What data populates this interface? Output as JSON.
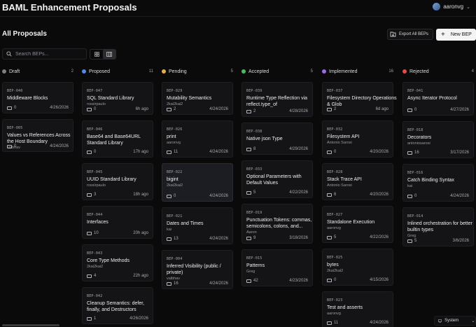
{
  "app": {
    "title": "BAML Enhancement Proposals"
  },
  "user": {
    "name": "aaronvg"
  },
  "page": {
    "title": "All Proposals"
  },
  "actions": {
    "export_label": "Export All BEPs",
    "new_label": "New BEP"
  },
  "search": {
    "placeholder": "Search BEPs..."
  },
  "theme": {
    "label": "System"
  },
  "colors": {
    "draft": "#7d7d85",
    "proposed": "#4f8be8",
    "pending": "#e3b341",
    "accepted": "#4cbb5f",
    "implemented": "#9b6be3",
    "rejected": "#e34b4b"
  },
  "columns": [
    {
      "name": "Draft",
      "count": "2",
      "cards": [
        {
          "id": "BEP-040",
          "title": "Middleware Blocks",
          "author": "",
          "comments": "0",
          "date": "4/26/2026"
        },
        {
          "id": "BEP-005",
          "title": "Values vs References Across the Host Boundary",
          "author": "vaibhav",
          "comments": "0",
          "date": "4/24/2026"
        }
      ]
    },
    {
      "name": "Proposed",
      "count": "11",
      "cards": [
        {
          "id": "BEP-047",
          "title": "SQL Standard Library",
          "author": "rossirpaulo",
          "comments": "0",
          "date": "6h ago"
        },
        {
          "id": "BEP-046",
          "title": "Base64 and Base64URL Standard Library",
          "author": "",
          "comments": "0",
          "date": "17h ago"
        },
        {
          "id": "BEP-045",
          "title": "UUID Standard Library",
          "author": "rossirpaulo",
          "comments": "3",
          "date": "18h ago"
        },
        {
          "id": "BEP-044",
          "title": "Interfaces",
          "author": "",
          "comments": "10",
          "date": "20h ago"
        },
        {
          "id": "BEP-043",
          "title": "Core Type Methods",
          "author": "2kai2kai2",
          "comments": "4",
          "date": "22h ago"
        },
        {
          "id": "BEP-042",
          "title": "Cleanup Semantics: defer, finally, and Destructors",
          "author": "",
          "comments": "1",
          "date": "4/26/2026"
        }
      ]
    },
    {
      "name": "Pending",
      "count": "5",
      "cards": [
        {
          "id": "BEP-029",
          "title": "Mutability Semantics",
          "author": "2kai2kai2",
          "comments": "2",
          "date": "4/24/2026"
        },
        {
          "id": "BEP-026",
          "title": "print",
          "author": "aaronvg",
          "comments": "11",
          "date": "4/24/2026"
        },
        {
          "id": "BEP-022",
          "title": "bigint",
          "author": "2kai2kai2",
          "comments": "0",
          "date": "4/24/2026"
        },
        {
          "id": "BEP-021",
          "title": "Dates and Times",
          "author": "kai",
          "comments": "13",
          "date": "4/24/2026"
        },
        {
          "id": "BEP-004",
          "title": "Inferred Visibility (public / private)",
          "author": "vaibhav",
          "comments": "16",
          "date": "4/24/2026"
        }
      ]
    },
    {
      "name": "Accepted",
      "count": "5",
      "cards": [
        {
          "id": "BEP-039",
          "title": "Runtime Type Reflection via reflect.type_of",
          "author": "",
          "comments": "2",
          "date": "4/28/2026"
        },
        {
          "id": "BEP-038",
          "title": "Native json Type",
          "author": "",
          "comments": "8",
          "date": "4/29/2026"
        },
        {
          "id": "BEP-033",
          "title": "Optional Parameters with Default Values",
          "author": "",
          "comments": "5",
          "date": "4/22/2026"
        },
        {
          "id": "BEP-019",
          "title": "Punctuation Tokens: commas, semicolons, colons, and...",
          "author": "Aaron",
          "comments": "9",
          "date": "3/18/2026"
        },
        {
          "id": "BEP-015",
          "title": "Patterns",
          "author": "Greg",
          "comments": "42",
          "date": "4/23/2026"
        }
      ]
    },
    {
      "name": "Implemented",
      "count": "16",
      "cards": [
        {
          "id": "BEP-037",
          "title": "Filesystem Directory Operations & Glob",
          "author": "",
          "comments": "2",
          "date": "6d ago"
        },
        {
          "id": "BEP-032",
          "title": "Filesystem API",
          "author": "Antonio Sarosi",
          "comments": "0",
          "date": "4/20/2026"
        },
        {
          "id": "BEP-028",
          "title": "Stack Trace API",
          "author": "Antonio Sarosi",
          "comments": "6",
          "date": "4/20/2026"
        },
        {
          "id": "BEP-027",
          "title": "Standalone Execution",
          "author": "aaronvg",
          "comments": "5",
          "date": "4/22/2026"
        },
        {
          "id": "BEP-025",
          "title": "bytes",
          "author": "2kai2kai2",
          "comments": "0",
          "date": "4/15/2026"
        },
        {
          "id": "BEP-023",
          "title": "Test and asserts",
          "author": "aaronvg",
          "comments": "11",
          "date": "4/24/2026"
        }
      ]
    },
    {
      "name": "Rejected",
      "count": "4",
      "cards": [
        {
          "id": "BEP-041",
          "title": "Async Iterator Protocol",
          "author": "",
          "comments": "0",
          "date": "4/27/2026"
        },
        {
          "id": "BEP-018",
          "title": "Decorators",
          "author": "antoniosarosi",
          "comments": "16",
          "date": "3/17/2026"
        },
        {
          "id": "BEP-016",
          "title": "Catch Binding Syntax",
          "author": "kai",
          "comments": "0",
          "date": "4/24/2026"
        },
        {
          "id": "BEP-014",
          "title": "Inlined orchestration for better builtin types",
          "author": "Greg",
          "comments": "5",
          "date": "3/6/2026"
        }
      ]
    }
  ]
}
